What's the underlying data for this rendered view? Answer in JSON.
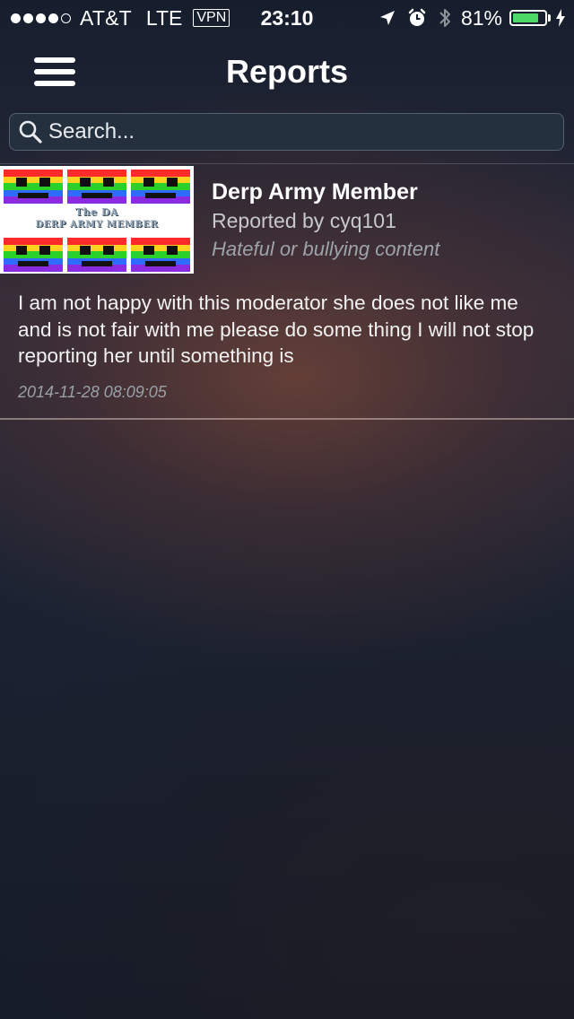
{
  "status_bar": {
    "carrier": "AT&T",
    "network": "LTE",
    "vpn": "VPN",
    "time": "23:10",
    "battery_percent": "81%",
    "battery_level": 0.81,
    "icons": [
      "signal-dots",
      "location-arrow-icon",
      "alarm-clock-icon",
      "bluetooth-icon",
      "battery-icon",
      "charging-bolt-icon"
    ]
  },
  "nav": {
    "title": "Reports",
    "menu_icon": "hamburger-menu-icon"
  },
  "search": {
    "placeholder": "Search...",
    "value": "",
    "icon": "search-icon"
  },
  "reports": [
    {
      "image_caption_line1": "The DA",
      "image_caption_line2": "DERP ARMY MEMBER",
      "title": "Derp Army Member",
      "reported_by": "Reported by cyq101",
      "reason": "Hateful or bullying content",
      "body": "I am not happy with this moderator she does not like me and is not fair with me please do some thing I will not stop reporting her until something is",
      "date": "2014-11-28 08:09:05"
    }
  ],
  "colors": {
    "accent_battery": "#4cd964",
    "background_dark": "#141d2c",
    "search_bg": "#25303f"
  }
}
